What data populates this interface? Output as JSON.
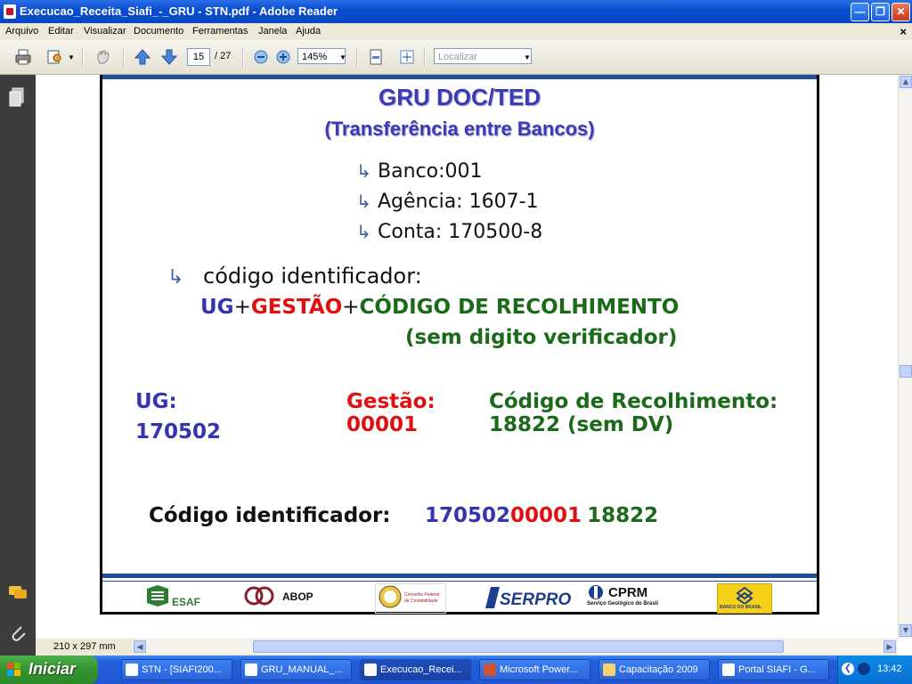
{
  "window": {
    "title": "Execucao_Receita_Siafi_-_GRU - STN.pdf - Adobe Reader"
  },
  "menu": [
    "Arquivo",
    "Editar",
    "Visualizar",
    "Documento",
    "Ferramentas",
    "Janela",
    "Ajuda"
  ],
  "toolbar": {
    "page_current": "15",
    "page_total": "/ 27",
    "zoom": "145%",
    "find_placeholder": "Localizar"
  },
  "status": {
    "page_size": "210 x 297 mm"
  },
  "slide": {
    "title": "GRU DOC/TED",
    "subtitle": "(Transferência entre Bancos)",
    "bank_items": [
      "Banco:001",
      "Agência: 1607-1",
      "Conta: 170500-8"
    ],
    "identifier_label": "código identificador:",
    "formula": {
      "ug": "UG",
      "plus1": "+",
      "gestao": "GESTÃO",
      "plus2": "+",
      "codigo": "CÓDIGO DE RECOLHIMENTO",
      "note": "(sem digito verificador)"
    },
    "ug_label": "UG:",
    "ug_value": "170502",
    "gestao_label": "Gestão:",
    "gestao_value": "00001",
    "codigo_label": "Código de Recolhimento:",
    "codigo_value": "18822 (sem DV)",
    "result_label": "Código identificador:",
    "result_ug": "170502",
    "result_gestao": "00001",
    "result_codigo": "18822",
    "logos": [
      "ESAF",
      "ABOP",
      "Conselho Federal de Contabilidade",
      "SERPRO",
      "CPRM",
      "Serviço Geológico do Brasil",
      "BANCO DO BRASIL"
    ]
  },
  "taskbar": {
    "start": "Iniciar",
    "tasks": [
      "STN - [SIAFI200...",
      "GRU_MANUAL_...",
      "Execucao_Recei...",
      "Microsoft Power...",
      "Capacitação 2009",
      "Portal SIAFI - G..."
    ],
    "clock": "13:42"
  }
}
